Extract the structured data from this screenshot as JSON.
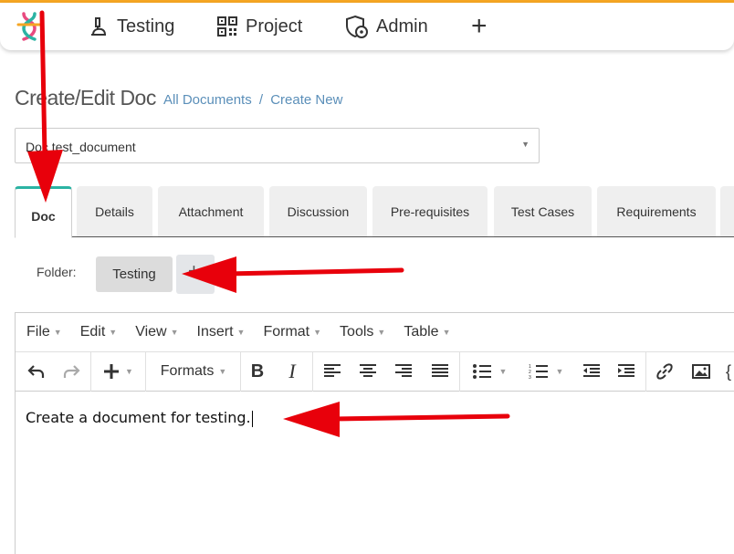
{
  "nav": {
    "items": [
      {
        "label": "Testing",
        "icon": "microscope-icon"
      },
      {
        "label": "Project",
        "icon": "qr-code-icon"
      },
      {
        "label": "Admin",
        "icon": "shield-gear-icon"
      }
    ],
    "add_label": "+"
  },
  "page": {
    "title": "Create/Edit Doc",
    "breadcrumb": {
      "all": "All Documents",
      "sep": "/",
      "current": "Create New"
    }
  },
  "doc_select": {
    "value": "Doc test_document"
  },
  "tabs": [
    "Doc",
    "Details",
    "Attachment",
    "Discussion",
    "Pre-requisites",
    "Test Cases",
    "Requirements"
  ],
  "folder": {
    "label": "Folder:",
    "value": "Testing",
    "add_label": "+"
  },
  "editor": {
    "menu": [
      "File",
      "Edit",
      "View",
      "Insert",
      "Format",
      "Tools",
      "Table"
    ],
    "formats_label": "Formats",
    "content": "Create a document for testing."
  },
  "colors": {
    "accent": "#2bb3a3",
    "link": "#5b8fb9",
    "arrow": "#e8000b",
    "top_strip": "#f5a623"
  }
}
